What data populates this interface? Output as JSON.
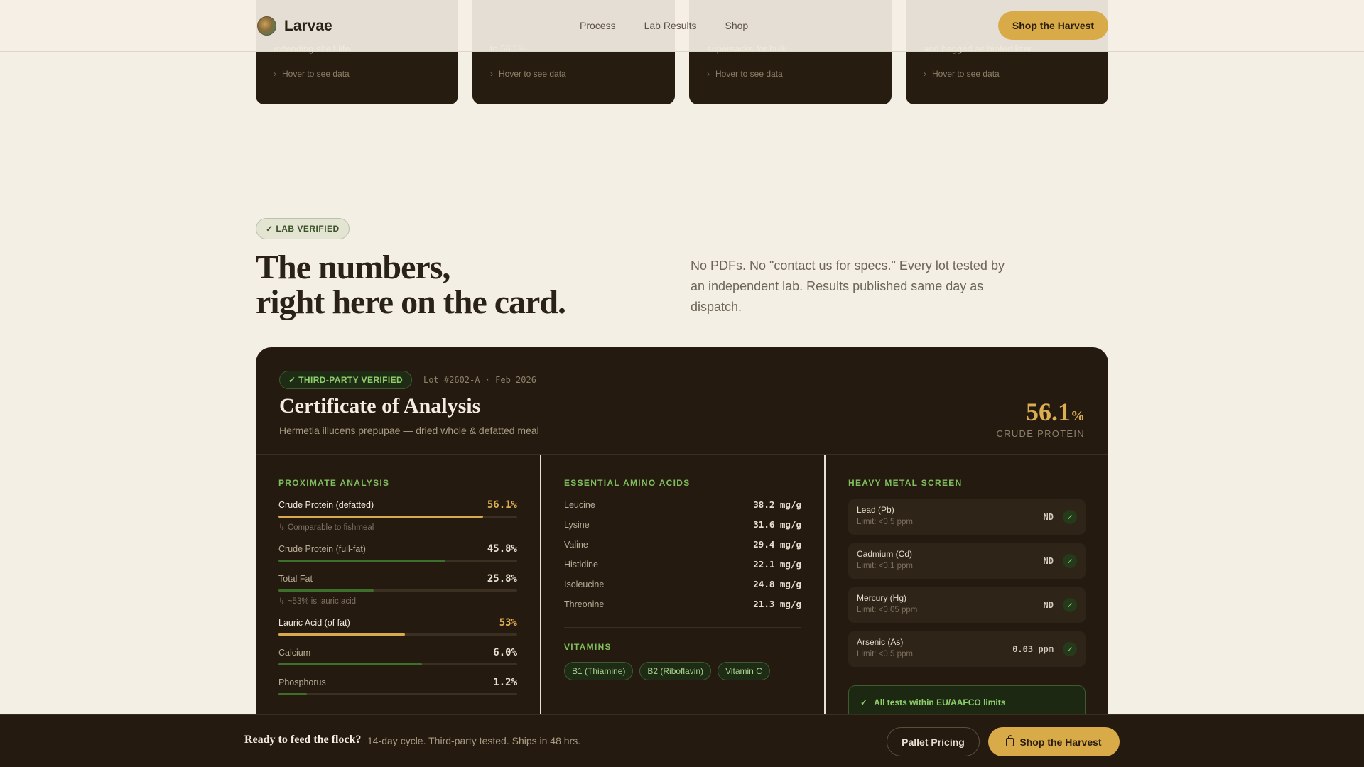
{
  "top_cards": [
    {
      "desc": "extending shelf life.",
      "hover": "Hover to see data"
    },
    {
      "desc": "to 56.1%.",
      "hover": "Hover to see data"
    },
    {
      "desc": "supersacks for bulk.",
      "hover": "Hover to see data"
    },
    {
      "desc": "and bagged as biofertilizer.",
      "hover": "Hover to see data"
    }
  ],
  "nav": {
    "brand": "Larvae",
    "links": [
      "Process",
      "Lab Results",
      "Shop"
    ],
    "cta": "Shop the Harvest"
  },
  "section": {
    "badge": "✓ LAB VERIFIED",
    "headline_line1": "The numbers,",
    "headline_line2": "right here on the card.",
    "lede": "No PDFs. No \"contact us for specs.\" Every lot tested by an independent lab. Results published same day as dispatch."
  },
  "certificate": {
    "pill": "✓ THIRD-PARTY VERIFIED",
    "lot": "Lot #2602-A · Feb 2026",
    "title": "Certificate of Analysis",
    "subtitle": "Hermetia illucens prepupae — dried whole & defatted meal",
    "headline_value": "56.1",
    "headline_unit": "%",
    "headline_label": "CRUDE PROTEIN",
    "proximate": {
      "heading": "PROXIMATE ANALYSIS",
      "items": [
        {
          "label": "Crude Protein (defatted)",
          "value": "56.1%",
          "fraction": 0.856,
          "highlight": true,
          "note": "↳ Comparable to fishmeal"
        },
        {
          "label": "Crude Protein (full-fat)",
          "value": "45.8%",
          "fraction": 0.7,
          "highlight": false,
          "note": ""
        },
        {
          "label": "Total Fat",
          "value": "25.8%",
          "fraction": 0.4,
          "highlight": false,
          "note": "↳ ~53% is lauric acid"
        },
        {
          "label": "Lauric Acid (of fat)",
          "value": "53%",
          "fraction": 0.53,
          "highlight": true,
          "note": ""
        },
        {
          "label": "Calcium",
          "value": "6.0%",
          "fraction": 0.6,
          "highlight": false,
          "note": ""
        },
        {
          "label": "Phosphorus",
          "value": "1.2%",
          "fraction": 0.12,
          "highlight": false,
          "note": ""
        }
      ]
    },
    "amino": {
      "heading": "ESSENTIAL AMINO ACIDS",
      "items": [
        {
          "name": "Leucine",
          "value": "38.2 mg/g"
        },
        {
          "name": "Lysine",
          "value": "31.6 mg/g"
        },
        {
          "name": "Valine",
          "value": "29.4 mg/g"
        },
        {
          "name": "Histidine",
          "value": "22.1 mg/g"
        },
        {
          "name": "Isoleucine",
          "value": "24.8 mg/g"
        },
        {
          "name": "Threonine",
          "value": "21.3 mg/g"
        }
      ],
      "vitamins_heading": "VITAMINS",
      "vitamins": [
        "B1 (Thiamine)",
        "B2 (Riboflavin)",
        "Vitamin C"
      ]
    },
    "metals": {
      "heading": "HEAVY METAL SCREEN",
      "items": [
        {
          "name": "Lead (Pb)",
          "limit": "Limit: <0.5 ppm",
          "result": "ND"
        },
        {
          "name": "Cadmium (Cd)",
          "limit": "Limit: <0.1 ppm",
          "result": "ND"
        },
        {
          "name": "Mercury (Hg)",
          "limit": "Limit: <0.05 ppm",
          "result": "ND"
        },
        {
          "name": "Arsenic (As)",
          "limit": "Limit: <0.5 ppm",
          "result": "0.03 ppm"
        }
      ],
      "summary": "All tests within EU/AAFCO limits"
    }
  },
  "footer": {
    "question": "Ready to feed the flock?",
    "sub": "14-day cycle. Third-party tested. Ships in 48 hrs.",
    "secondary": "Pallet Pricing",
    "primary": "Shop the Harvest"
  },
  "icons": {
    "check": "check-icon",
    "chevron": "chevron-right-icon",
    "bag": "shopping-bag-icon",
    "logo": "larvae-logo-icon"
  },
  "colors": {
    "accent_gold": "#d9aa48",
    "dark_card": "#241a0f",
    "verified_green": "#8fcf6b",
    "page_bg": "#f4efe5"
  }
}
